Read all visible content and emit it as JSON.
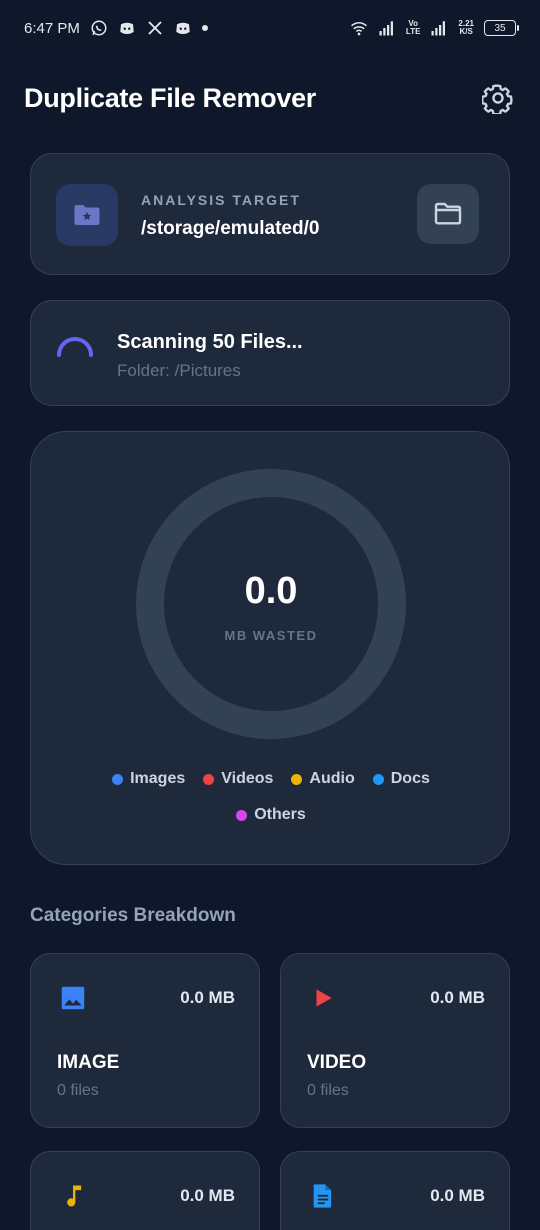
{
  "status_bar": {
    "time": "6:47 PM",
    "net_speed_top": "2.21",
    "net_speed_bottom": "K/S",
    "volte_top": "Vo",
    "volte_bottom": "LTE",
    "battery": "35"
  },
  "header": {
    "title": "Duplicate File Remover",
    "settings_icon": "gear-icon"
  },
  "analysis_target": {
    "label": "ANALYSIS TARGET",
    "path": "/storage/emulated/0"
  },
  "scan": {
    "title": "Scanning 50 Files...",
    "subtitle": "Folder: /Pictures"
  },
  "summary": {
    "value": "0.0",
    "unit": "MB WASTED",
    "legend": [
      {
        "label": "Images",
        "color": "#3b82f6"
      },
      {
        "label": "Videos",
        "color": "#ef4444"
      },
      {
        "label": "Audio",
        "color": "#eab308"
      },
      {
        "label": "Docs",
        "color": "#2196f3"
      },
      {
        "label": "Others",
        "color": "#d946ef"
      }
    ]
  },
  "categories": {
    "title": "Categories Breakdown",
    "items": [
      {
        "name": "IMAGE",
        "size": "0.0 MB",
        "count": "0 files",
        "icon": "image-icon",
        "color": "#3b82f6"
      },
      {
        "name": "VIDEO",
        "size": "0.0 MB",
        "count": "0 files",
        "icon": "play-icon",
        "color": "#ef4444"
      },
      {
        "name": "",
        "size": "0.0 MB",
        "count": "",
        "icon": "music-note-icon",
        "color": "#eab308"
      },
      {
        "name": "",
        "size": "0.0 MB",
        "count": "",
        "icon": "document-icon",
        "color": "#2196f3"
      }
    ]
  },
  "colors": {
    "background": "#0f172a",
    "card": "#1e293b",
    "accent": "#6366f1"
  }
}
